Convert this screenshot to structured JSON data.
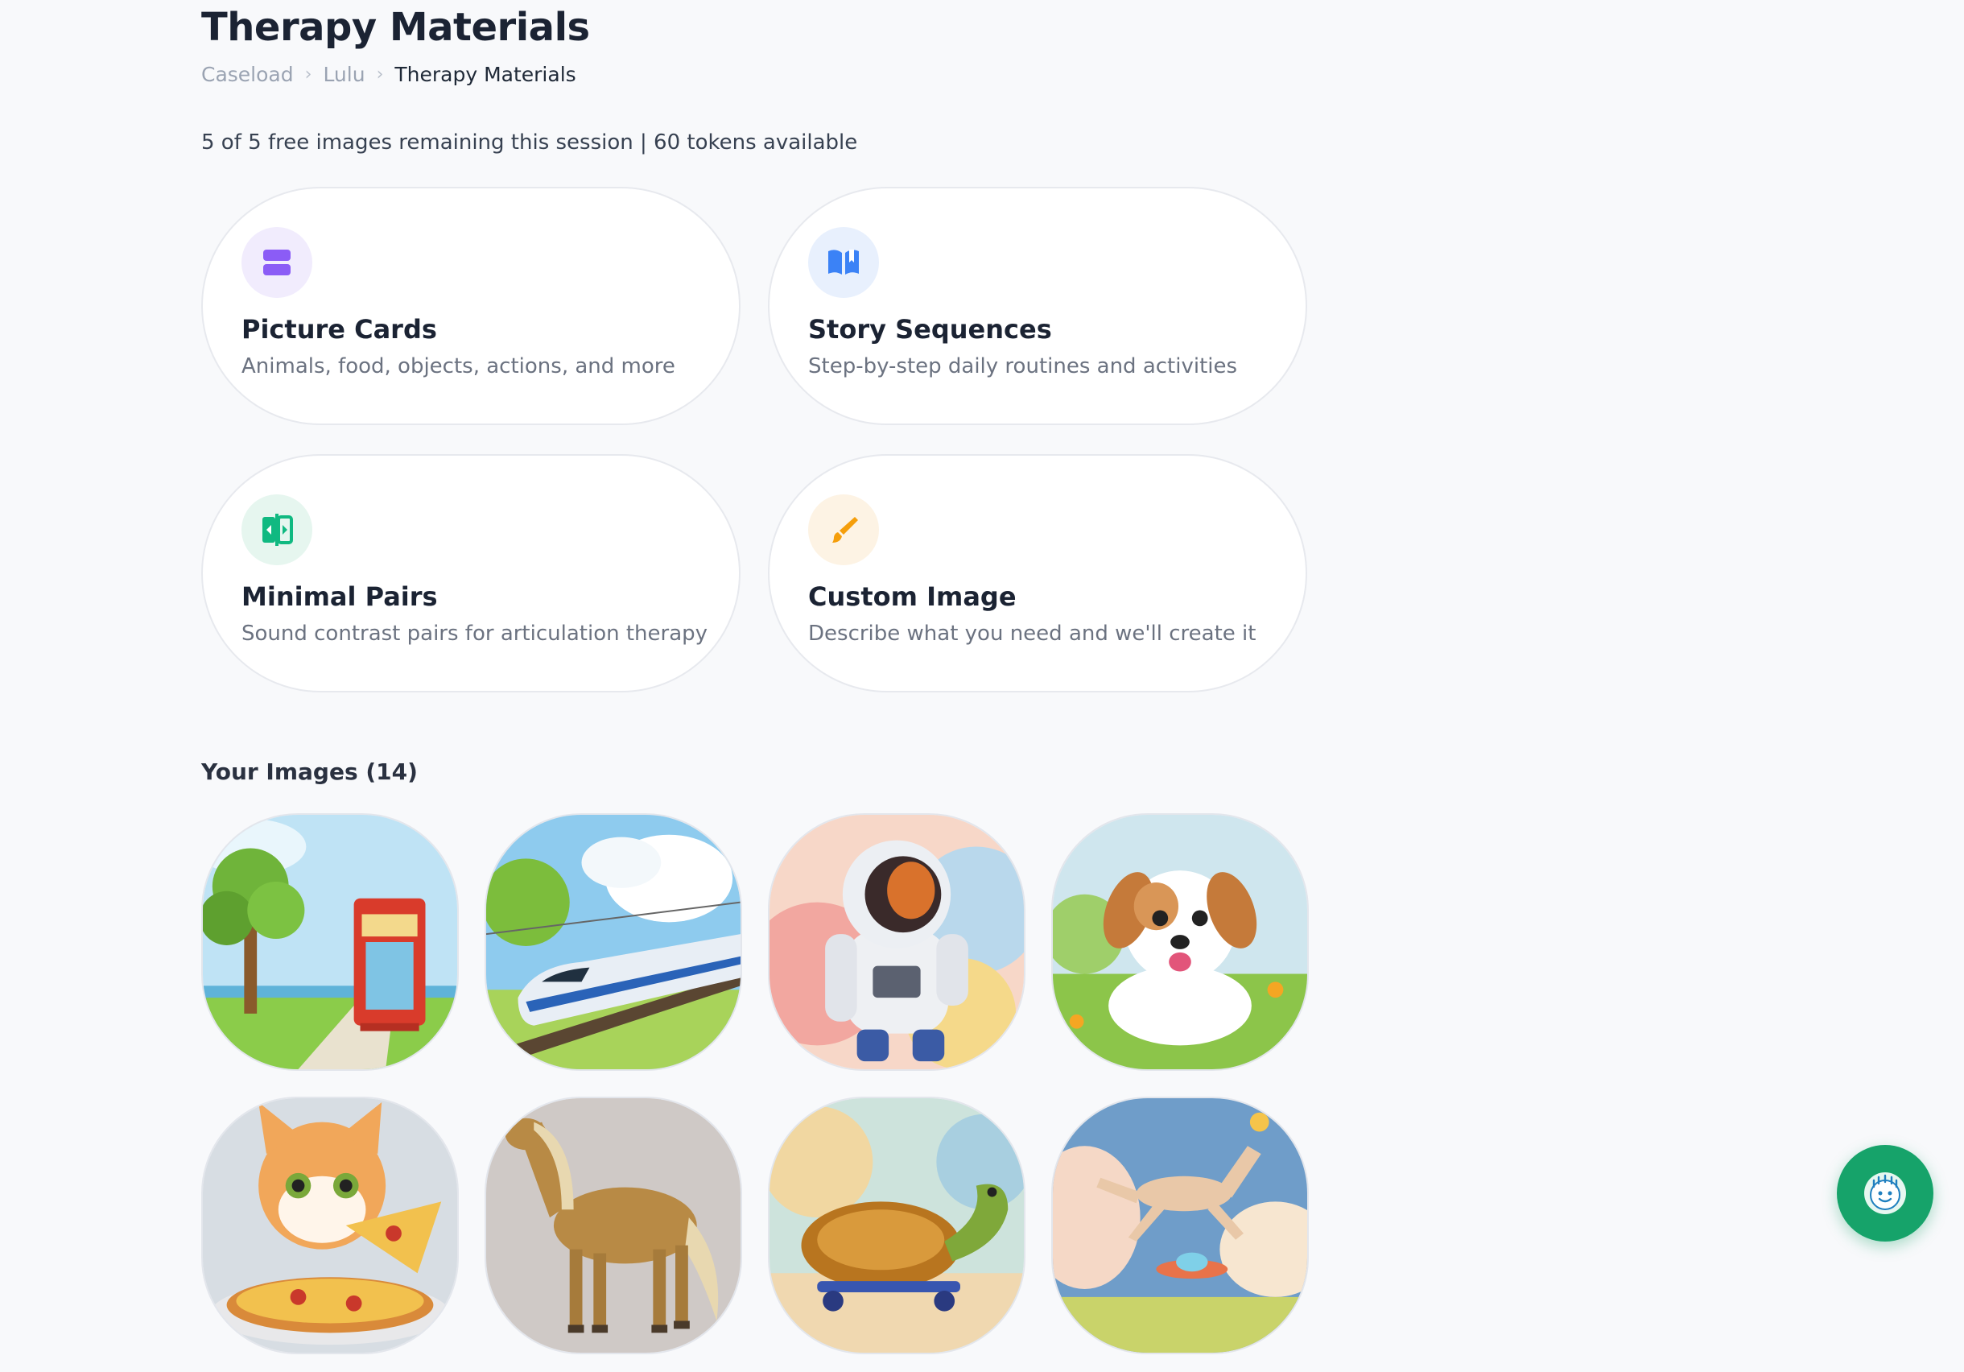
{
  "header": {
    "title": "Therapy Materials",
    "breadcrumb": [
      "Caseload",
      "Lulu",
      "Therapy Materials"
    ]
  },
  "quota_text": "5 of 5 free images remaining this session | 60 tokens available",
  "material_types": [
    {
      "title": "Picture Cards",
      "description": "Animals, food, objects, actions, and more",
      "icon": "layers-icon",
      "icon_color": "#8b5cf6",
      "icon_bg": "#f1ecfd"
    },
    {
      "title": "Story Sequences",
      "description": "Step-by-step daily routines and activities",
      "icon": "book-open-icon",
      "icon_color": "#3b82f6",
      "icon_bg": "#e8f0fd"
    },
    {
      "title": "Minimal Pairs",
      "description": "Sound contrast pairs for articulation therapy",
      "icon": "compare-icon",
      "icon_color": "#10b981",
      "icon_bg": "#e6f6ef"
    },
    {
      "title": "Custom Image",
      "description": "Describe what you need and we'll create it",
      "icon": "paintbrush-icon",
      "icon_color": "#f59e0b",
      "icon_bg": "#fdf3e4"
    }
  ],
  "images_section": {
    "title": "Your Images (14)",
    "images": [
      {
        "subject": "tree-and-phone-booth"
      },
      {
        "subject": "high-speed-train"
      },
      {
        "subject": "astronaut"
      },
      {
        "subject": "puppy"
      },
      {
        "subject": "cat-eating-pizza"
      },
      {
        "subject": "horse"
      },
      {
        "subject": "turtle-on-skateboard"
      },
      {
        "subject": "jumping-horse-and-ufo"
      }
    ]
  },
  "assistant_button": {
    "icon": "assistant-face-icon"
  }
}
